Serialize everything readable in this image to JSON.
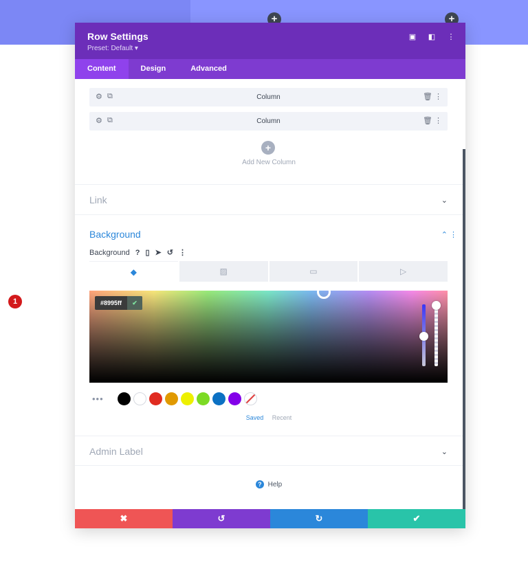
{
  "top_bg": {
    "add_icon_1": "+",
    "add_icon_2": "+"
  },
  "header": {
    "title": "Row Settings",
    "preset": "Preset: Default ▾",
    "icons": [
      "expand-icon",
      "split-icon",
      "more-icon"
    ]
  },
  "tabs": [
    {
      "label": "Content"
    },
    {
      "label": "Design"
    },
    {
      "label": "Advanced"
    }
  ],
  "columns": [
    {
      "label": "Column"
    },
    {
      "label": "Column"
    }
  ],
  "add_column": {
    "icon": "+",
    "label": "Add New Column"
  },
  "link_section": {
    "title": "Link"
  },
  "background_section": {
    "title": "Background",
    "field_label": "Background",
    "field_icons": [
      "help-icon",
      "mobile-icon",
      "cursor-icon",
      "undo-icon",
      "more-icon"
    ],
    "tab_icons": [
      "paint-bucket-icon",
      "gradient-icon",
      "image-icon",
      "video-icon"
    ],
    "hex_value": "#8995ff",
    "marker": "1",
    "swatches": [
      "#000000",
      "#ffffff",
      "#e02b20",
      "#e09900",
      "#edf000",
      "#7cda24",
      "#0c71c3",
      "#8300e9"
    ],
    "saved_label": "Saved",
    "recent_label": "Recent"
  },
  "admin_label_section": {
    "title": "Admin Label"
  },
  "help": {
    "label": "Help"
  },
  "footer": {
    "cancel": "✖",
    "undo": "↺",
    "redo": "↻",
    "save": "✔",
    "colors": {
      "cancel": "#ef5555",
      "undo": "#7e3bd0",
      "redo": "#2b87da",
      "save": "#29c4a9"
    }
  }
}
